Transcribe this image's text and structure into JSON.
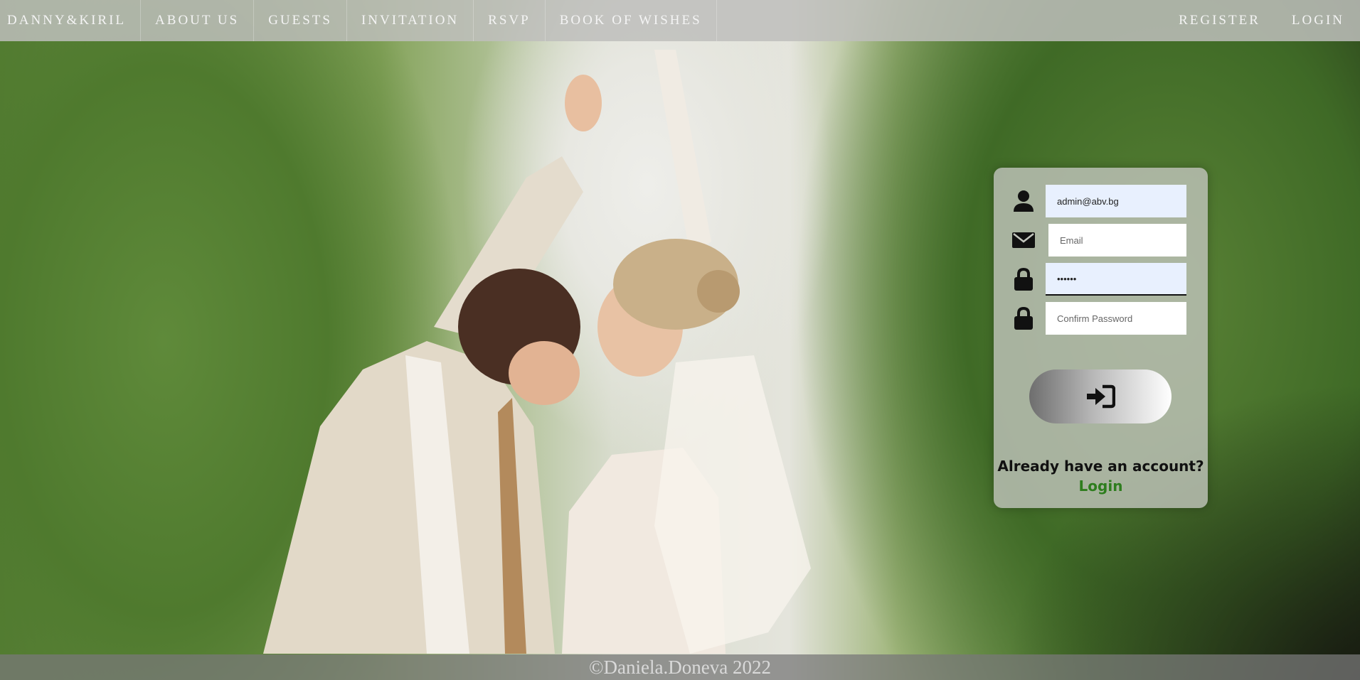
{
  "nav": {
    "brand": "DANNY&KIRIL",
    "items": [
      "ABOUT US",
      "GUESTS",
      "INVITATION",
      "RSVP",
      "BOOK OF WISHES"
    ],
    "right": [
      "REGISTER",
      "LOGIN"
    ]
  },
  "form": {
    "username_value": "admin@abv.bg",
    "email_placeholder": "Email",
    "password_value": "••••••",
    "confirm_placeholder": "Confirm Password",
    "icons": [
      "user-icon",
      "envelope-icon",
      "lock-icon",
      "lock-icon"
    ],
    "submit_icon": "sign-in-icon",
    "account_text": "Already have an account?",
    "login_link": "Login"
  },
  "footer": {
    "text": "©Daniela.Doneva 2022"
  },
  "colors": {
    "link_green": "#2e7d1e",
    "nav_bg": "#bebebc"
  }
}
